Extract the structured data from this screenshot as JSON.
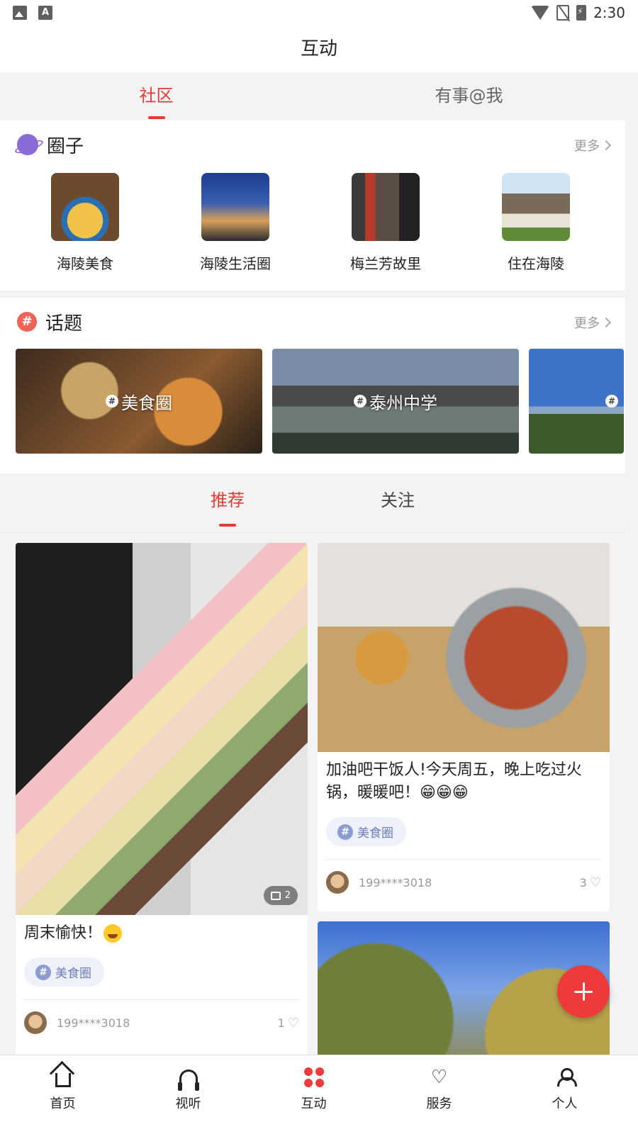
{
  "status_bar": {
    "time": "2:30"
  },
  "header": {
    "title": "互动"
  },
  "top_tabs": [
    {
      "label": "社区",
      "active": true
    },
    {
      "label": "有事@我",
      "active": false
    }
  ],
  "circles": {
    "title": "圈子",
    "more_label": "更多",
    "items": [
      {
        "label": "海陵美食"
      },
      {
        "label": "海陵生活圈"
      },
      {
        "label": "梅兰芳故里"
      },
      {
        "label": "住在海陵"
      }
    ]
  },
  "topics": {
    "title": "话题",
    "more_label": "更多",
    "items": [
      {
        "label": "美食圈"
      },
      {
        "label": "泰州中学"
      },
      {
        "label": ""
      }
    ]
  },
  "feed_tabs": [
    {
      "label": "推荐",
      "active": true
    },
    {
      "label": "关注",
      "active": false
    }
  ],
  "posts": [
    {
      "image_count": "2",
      "text": "周末愉快！",
      "tag": "美食圈",
      "user": "199****3018",
      "likes": "1"
    },
    {
      "text": "加油吧干饭人!今天周五，晚上吃过火锅，暖暖吧！😁😁😁",
      "tag": "美食圈",
      "user": "199****3018",
      "likes": "3"
    }
  ],
  "bottom_nav": [
    {
      "label": "首页"
    },
    {
      "label": "视听"
    },
    {
      "label": "互动",
      "active": true
    },
    {
      "label": "服务"
    },
    {
      "label": "个人"
    }
  ],
  "colors": {
    "accent": "#e53935",
    "fab": "#ee3a3a",
    "tag_text": "#6c7fb6"
  }
}
